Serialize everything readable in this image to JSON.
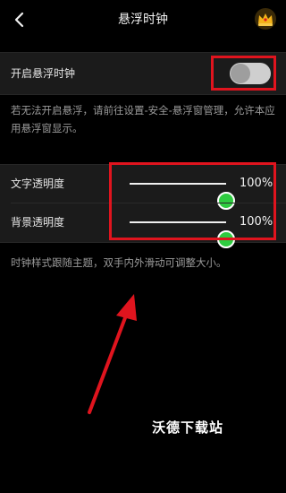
{
  "header": {
    "title": "悬浮时钟",
    "back_icon": "chevron-left-icon",
    "crown_icon": "crown-icon"
  },
  "float_clock": {
    "label": "开启悬浮时钟",
    "enabled": false
  },
  "permission_hint": "若无法开启悬浮，请前往设置-安全-悬浮窗管理，允许本应用悬浮窗显示。",
  "sliders": [
    {
      "label": "文字透明度",
      "value_text": "100%",
      "value": 100
    },
    {
      "label": "背景透明度",
      "value_text": "100%",
      "value": 100
    }
  ],
  "style_hint": "时钟样式跟随主题，双手内外滑动可调整大小。",
  "watermark_text": "沃德下载站",
  "colors": {
    "background": "#000000",
    "row_bg": "#1b1b1b",
    "accent_green": "#2ecc40",
    "annotation_red": "#e0141e",
    "crown_gold": "#f3b21a"
  }
}
